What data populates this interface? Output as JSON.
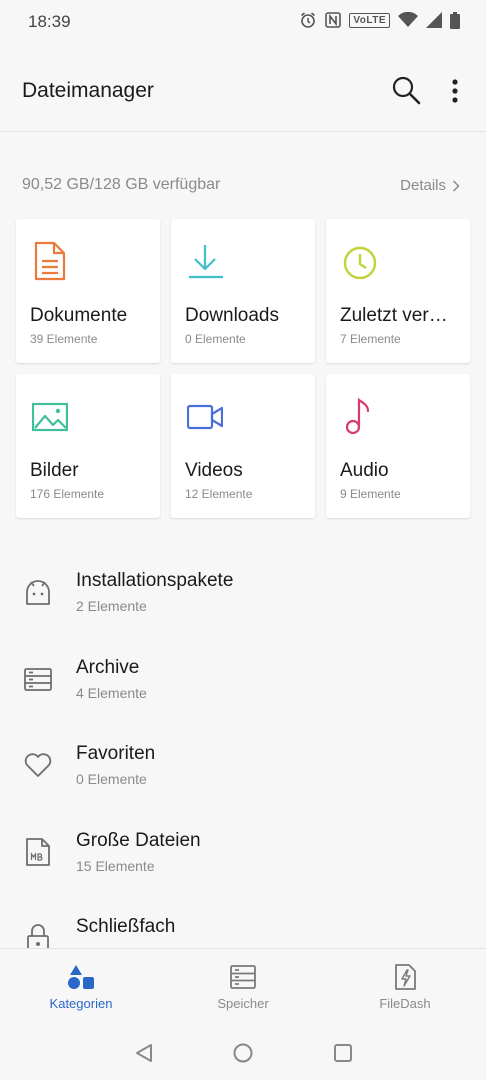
{
  "status_bar": {
    "time": "18:39",
    "volte": "VoLTE",
    "icons": [
      "alarm-icon",
      "nfc-icon",
      "volte-icon",
      "wifi-icon",
      "signal-icon",
      "battery-icon"
    ]
  },
  "app_bar": {
    "title": "Dateimanager",
    "icons": [
      "search-icon",
      "more-vert-icon"
    ]
  },
  "storage": {
    "summary": "90,52 GB/128 GB verfügbar",
    "details_label": "Details"
  },
  "categories": [
    {
      "name": "Dokumente",
      "count": "39 Elemente",
      "icon": "document-icon",
      "color": "#ec7a3c"
    },
    {
      "name": "Downloads",
      "count": "0 Elemente",
      "icon": "download-icon",
      "color": "#3fbfc8"
    },
    {
      "name": "Zuletzt ver…",
      "count": "7 Elemente",
      "icon": "clock-icon",
      "color": "#c3d234"
    },
    {
      "name": "Bilder",
      "count": "176 Elemente",
      "icon": "image-icon",
      "color": "#3fbf9a"
    },
    {
      "name": "Videos",
      "count": "12 Elemente",
      "icon": "video-icon",
      "color": "#4a6fd8"
    },
    {
      "name": "Audio",
      "count": "9 Elemente",
      "icon": "music-note-icon",
      "color": "#d83a6a"
    }
  ],
  "list": [
    {
      "name": "Installationspakete",
      "count": "2 Elemente",
      "icon": "android-icon"
    },
    {
      "name": "Archive",
      "count": "4 Elemente",
      "icon": "archive-icon"
    },
    {
      "name": "Favoriten",
      "count": "0 Elemente",
      "icon": "heart-icon"
    },
    {
      "name": "Große Dateien",
      "count": "15 Elemente",
      "icon": "large-file-icon"
    },
    {
      "name": "Schließfach",
      "count": "",
      "icon": "lock-icon"
    }
  ],
  "bottom_nav": [
    {
      "label": "Kategorien",
      "icon": "categories-icon",
      "active": true
    },
    {
      "label": "Speicher",
      "icon": "storage-icon",
      "active": false
    },
    {
      "label": "FileDash",
      "icon": "filedash-icon",
      "active": false
    }
  ],
  "colors": {
    "accent": "#2a68c8",
    "secondary_text": "#8a8a8a",
    "icon_gray": "#6e6e6e"
  },
  "system_nav": [
    "back-icon",
    "home-icon",
    "recents-icon"
  ]
}
